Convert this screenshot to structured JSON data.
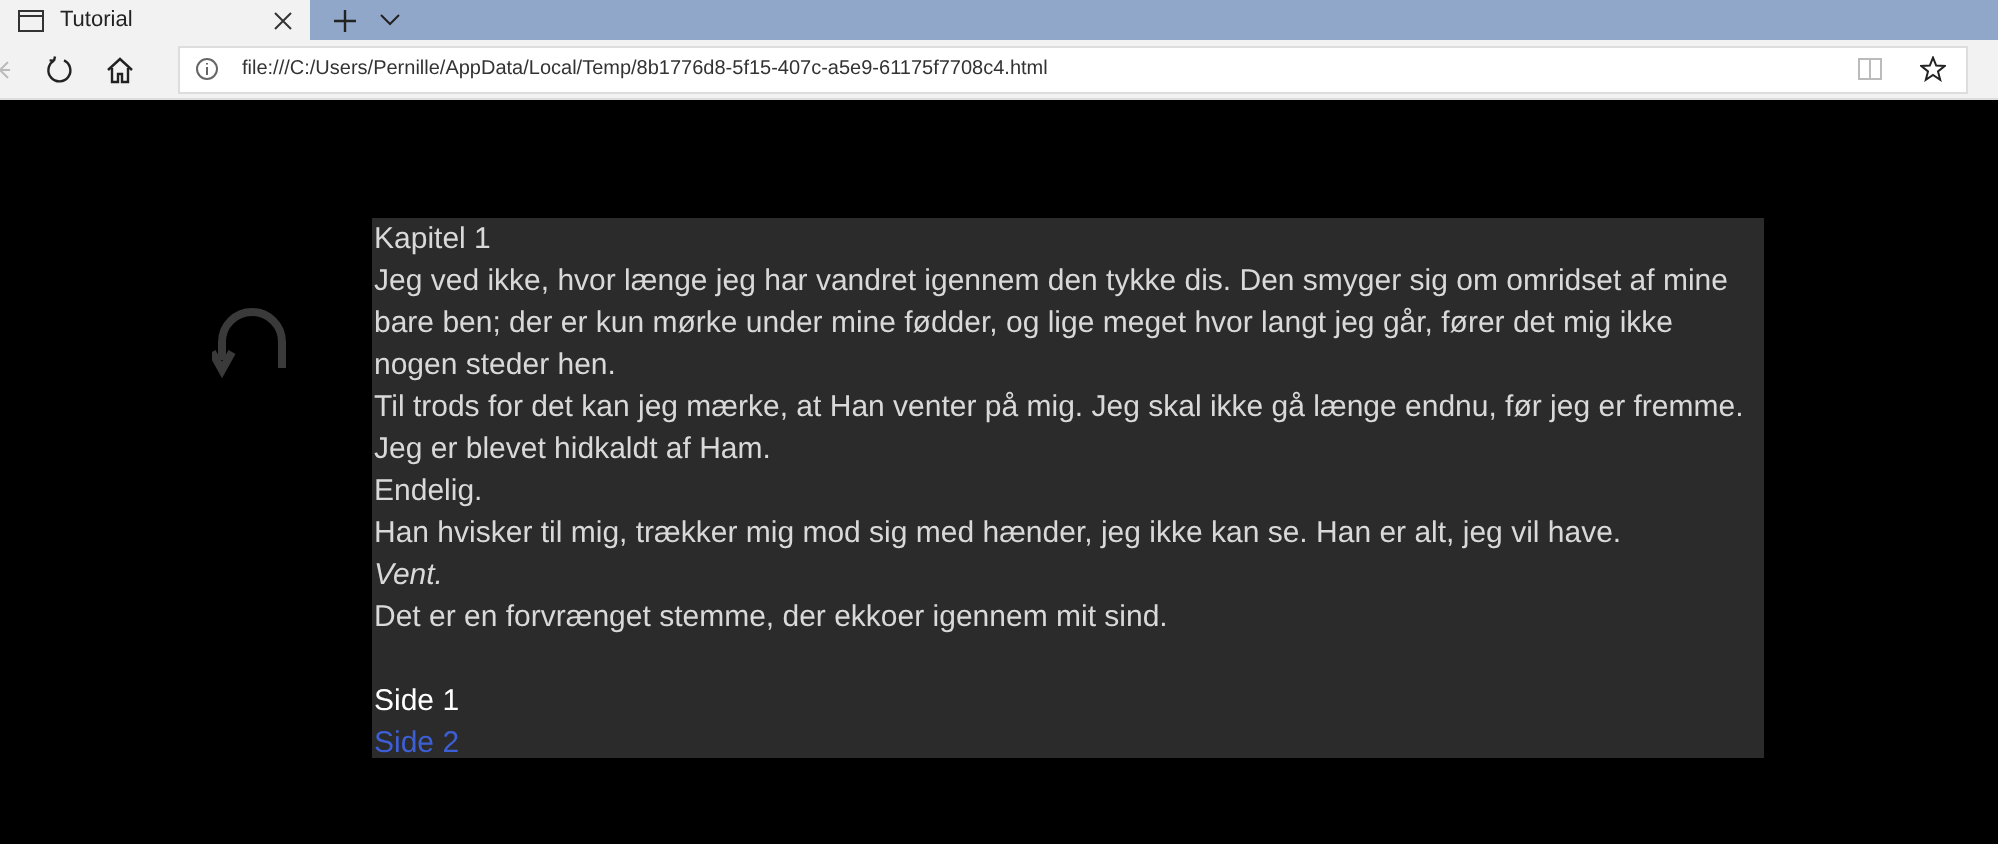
{
  "tabs": [
    {
      "title": "Tutorial",
      "selected": true
    }
  ],
  "address_bar": {
    "url": "file:///C:/Users/Pernille/AppData/Local/Temp/8b1776d8-5f15-407c-a5e9-61175f7708c4.html"
  },
  "page": {
    "heading": "Kapitel 1",
    "paragraphs": [
      {
        "kind": "normal",
        "text": "Jeg ved ikke, hvor længe jeg har vandret igennem den tykke dis. Den smyger sig om omridset af mine bare ben; der er kun mørke under mine fødder, og lige meget hvor langt jeg går, fører det mig ikke nogen steder hen."
      },
      {
        "kind": "normal",
        "text": "Til trods for det kan jeg mærke, at Han venter på mig. Jeg skal ikke gå længe endnu, før jeg er fremme. Jeg er blevet hidkaldt af Ham."
      },
      {
        "kind": "normal",
        "text": "Endelig."
      },
      {
        "kind": "normal",
        "text": "Han hvisker til mig, trækker mig mod sig med hænder, jeg ikke kan se. Han er alt, jeg vil have."
      },
      {
        "kind": "italic",
        "text": "Vent."
      },
      {
        "kind": "normal",
        "text": "Det er en forvrænget stemme, der ekkoer igennem mit sind."
      }
    ],
    "pages": [
      {
        "label": "Side 1",
        "selected": true
      },
      {
        "label": "Side 2",
        "selected": false
      }
    ]
  }
}
